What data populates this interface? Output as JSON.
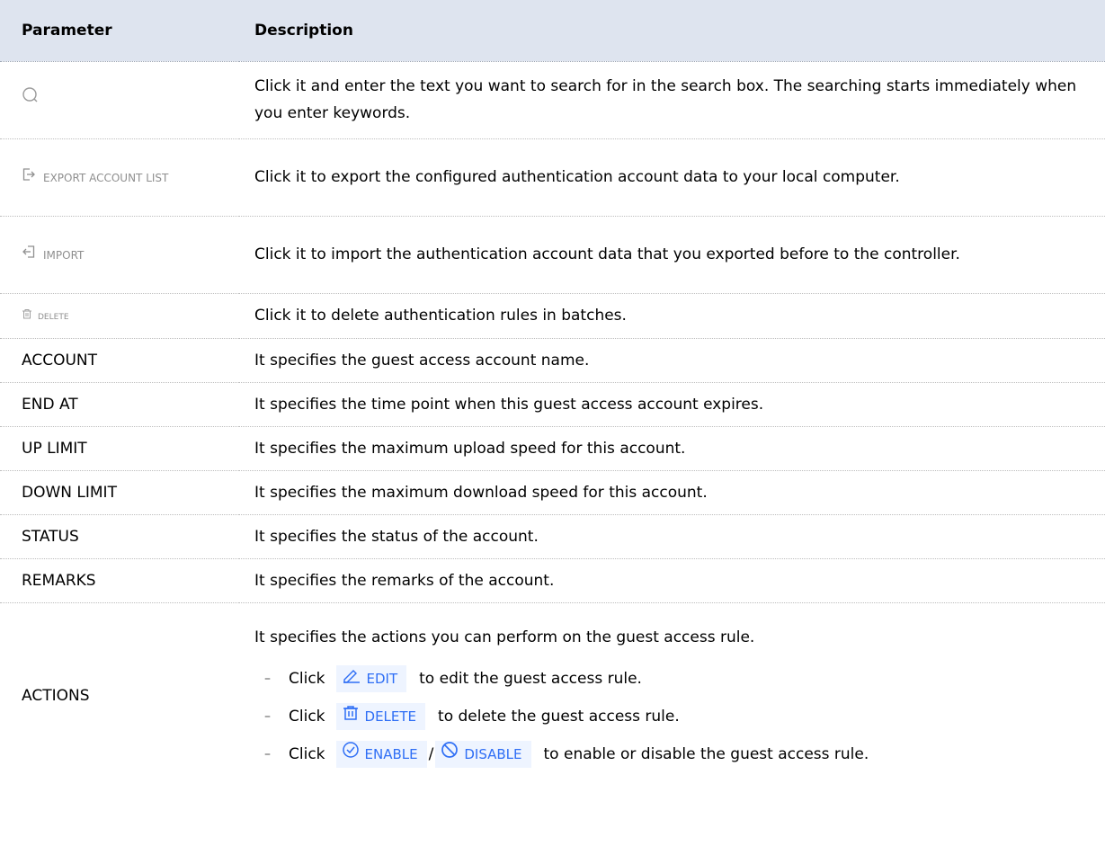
{
  "table": {
    "header": {
      "param": "Parameter",
      "desc": "Description"
    },
    "rows": {
      "search": {
        "icon": "search-icon",
        "desc": "Click it and enter the text you want to search for in the search box. The searching starts immediately when you enter keywords."
      },
      "export": {
        "label": "EXPORT ACCOUNT LIST",
        "icon": "export-icon",
        "desc": "Click it to export the configured authentication account data to your local computer."
      },
      "import": {
        "label": "IMPORT",
        "icon": "import-icon",
        "desc": "Click it to import the authentication account data that you exported before to the controller."
      },
      "delete": {
        "label": "DELETE",
        "icon": "trash-icon",
        "desc": "Click it to delete authentication rules in batches."
      },
      "account": {
        "param": "ACCOUNT",
        "desc": "It specifies the guest access account name."
      },
      "end_at": {
        "param": "END AT",
        "desc": "It specifies the time point when this guest access account expires."
      },
      "up_limit": {
        "param": "UP LIMIT",
        "desc": "It specifies the maximum upload speed for this account."
      },
      "down_limit": {
        "param": "DOWN LIMIT",
        "desc": "It specifies the maximum download speed for this account."
      },
      "status": {
        "param": "STATUS",
        "desc": "It specifies the status of the account."
      },
      "remarks": {
        "param": "REMARKS",
        "desc": "It specifies the remarks of the account."
      },
      "actions": {
        "param": "ACTIONS",
        "intro": "It specifies the actions you can perform on the guest access rule.",
        "bullet": "–",
        "click_word": "Click",
        "edit_label": "EDIT",
        "edit_text": "to edit the guest access rule.",
        "delete_label": "DELETE",
        "delete_text": "to delete the guest access rule.",
        "enable_label": "ENABLE",
        "slash": "/",
        "disable_label": "DISABLE",
        "enable_text": "to enable or disable the guest access rule."
      }
    }
  },
  "colors": {
    "header_bg": "#dee4ef",
    "button_blue": "#2e6ef5",
    "button_bg": "#eef4ff",
    "gray_icon": "#8f8f8f"
  }
}
